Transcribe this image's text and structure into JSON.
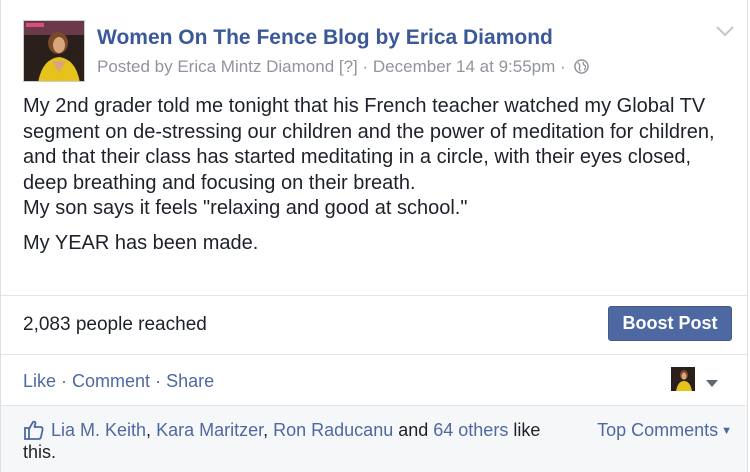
{
  "post": {
    "page_name": "Women On The Fence Blog by Erica Diamond",
    "posted_by_prefix": "Posted by ",
    "posted_by_name": "Erica Mintz Diamond",
    "help_marker": " [?]",
    "separator": " · ",
    "timestamp": "December 14 at 9:55pm",
    "privacy_icon": "globe-icon",
    "paragraphs": [
      "My 2nd grader told me tonight that his French teacher watched my Global TV segment on de-stressing our children and the power of meditation for children, and that their class has started meditating in a circle, with their eyes closed, deep breathing and focusing on their breath.",
      "My son says it feels \"relaxing and good at school.\""
    ],
    "closing_line": "My YEAR has been made."
  },
  "insights": {
    "reach_text": "2,083 people reached",
    "boost_label": "Boost Post"
  },
  "actions": {
    "like": "Like",
    "comment": "Comment",
    "share": "Share",
    "dot": " · "
  },
  "likes": {
    "names": [
      "Lia M. Keith",
      "Kara Maritzer",
      "Ron Raducanu"
    ],
    "comma": ", ",
    "and_text": " and ",
    "others": "64 others",
    "suffix_1": " like",
    "suffix_2": "this.",
    "top_comments": "Top Comments"
  },
  "colors": {
    "link_blue": "#3b5998",
    "button_blue": "#4e69a2",
    "meta_gray": "#90949c",
    "text": "#1d2129"
  }
}
